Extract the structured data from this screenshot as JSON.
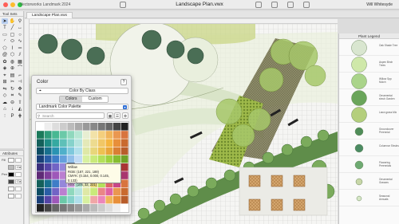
{
  "app": {
    "name": "Vectorworks Landmark 2024",
    "document_title": "Landscape Plan.vwx",
    "user": "Will Whitesyde",
    "traffic_lights": [
      "#ff5f57",
      "#febc2e",
      "#28c840"
    ]
  },
  "tabs": [
    {
      "label": "Landscape Plan.vwx"
    }
  ],
  "toolset": {
    "title": "Tool Sets",
    "tools": [
      {
        "icon": "selection-arrow-icon",
        "glyph": "➤"
      },
      {
        "icon": "pan-hand-icon",
        "glyph": "✋"
      },
      {
        "icon": "zoom-icon",
        "glyph": "⚲"
      },
      {
        "icon": "text-icon",
        "glyph": "T"
      },
      {
        "icon": "line-icon",
        "glyph": "╱"
      },
      {
        "icon": "dimension-icon",
        "glyph": "↔"
      },
      {
        "icon": "rectangle-icon",
        "glyph": "▭"
      },
      {
        "icon": "rounded-rectangle-icon",
        "glyph": "▢"
      },
      {
        "icon": "circle-icon",
        "glyph": "○"
      },
      {
        "icon": "arc-icon",
        "glyph": "◜"
      },
      {
        "icon": "oval-icon",
        "glyph": "⬭"
      },
      {
        "icon": "freehand-icon",
        "glyph": "∿"
      },
      {
        "icon": "polygon-icon",
        "glyph": "⬠"
      },
      {
        "icon": "polyline-icon",
        "glyph": "⌇"
      },
      {
        "icon": "double-line-icon",
        "glyph": "═"
      },
      {
        "icon": "spiral-icon",
        "glyph": "@"
      },
      {
        "icon": "regular-polygon-icon",
        "glyph": "⬡"
      },
      {
        "icon": "offset-icon",
        "glyph": "⫽"
      },
      {
        "icon": "plant-icon",
        "glyph": "✿"
      },
      {
        "icon": "massing-icon",
        "glyph": "◍"
      },
      {
        "icon": "hardscape-icon",
        "glyph": "▦"
      },
      {
        "icon": "site-modifier-icon",
        "glyph": "◈"
      },
      {
        "icon": "irrigation-icon",
        "glyph": "⊕"
      },
      {
        "icon": "pipe-icon",
        "glyph": "⌒"
      },
      {
        "icon": "eyedropper-icon",
        "glyph": "⌖"
      },
      {
        "icon": "attribute-mapping-icon",
        "glyph": "▤"
      },
      {
        "icon": "fillet-icon",
        "glyph": "⌐"
      },
      {
        "icon": "connect-combine-icon",
        "glyph": "⊞"
      },
      {
        "icon": "split-icon",
        "glyph": "✂"
      },
      {
        "icon": "trim-icon",
        "glyph": "⊣"
      },
      {
        "icon": "mirror-icon",
        "glyph": "⇋"
      },
      {
        "icon": "rotate-icon",
        "glyph": "↻"
      },
      {
        "icon": "move-icon",
        "glyph": "✥"
      },
      {
        "icon": "reshape-icon",
        "glyph": "◇"
      },
      {
        "icon": "label-icon",
        "glyph": "⌗"
      },
      {
        "icon": "callout-icon",
        "glyph": "✎"
      },
      {
        "icon": "revision-cloud-icon",
        "glyph": "☁"
      },
      {
        "icon": "section-marker-icon",
        "glyph": "⊖"
      },
      {
        "icon": "north-arrow-icon",
        "glyph": "⇧"
      },
      {
        "icon": "survey-input-icon",
        "glyph": "⌂"
      },
      {
        "icon": "stake-icon",
        "glyph": "↓"
      },
      {
        "icon": "grade-icon",
        "glyph": "◭"
      },
      {
        "icon": "road-icon",
        "glyph": "⫶"
      },
      {
        "icon": "parking-icon",
        "glyph": "P"
      },
      {
        "icon": "fence-icon",
        "glyph": "⋕"
      }
    ]
  },
  "attributes": {
    "title": "Attributes",
    "rows": [
      {
        "label": "Fill",
        "swatch": "#ffffff",
        "value": ""
      },
      {
        "label": "",
        "swatch": "#bbbbbb",
        "value": "Class Style"
      },
      {
        "label": "Pen",
        "swatch": "#000000",
        "value": ""
      },
      {
        "label": "",
        "swatch": "#444444",
        "value": "Class Style"
      },
      {
        "label": "",
        "swatch": "#ffffff",
        "value": ""
      },
      {
        "label": "",
        "swatch": "#ffffff",
        "value": ""
      }
    ]
  },
  "color_dialog": {
    "title": "Color",
    "help_label": "?",
    "by_class_label": "Color By Class",
    "tabs": [
      {
        "label": "Colors",
        "active": true
      },
      {
        "label": "Custom",
        "active": false
      }
    ],
    "palette_select": "Landmark Color Palette",
    "search_placeholder": "Search",
    "tooltip": {
      "name": "Willow",
      "rgb": "RGB: (187, 221, 189)",
      "cmyk": "CMYK: (0.154, 0.000, 0.145, 0.133)",
      "hsv": "HSV: (105, 32, 221)"
    }
  },
  "plant_list": {
    "title": "Plant Legend",
    "items": [
      {
        "color": "#d9e6d0",
        "label": "Oak Shade Tree"
      },
      {
        "color": "#cfe8a9",
        "label": "Aspen Birch Trees"
      },
      {
        "color": "#aad48a",
        "label": "Willow Spp Mulch"
      },
      {
        "color": "#6aa55a",
        "label": "Ornamental shrub Garden"
      },
      {
        "color": "#b4cf7c",
        "label": "Lawn grass Mix"
      },
      {
        "color": "#4f8c58",
        "label": "Groundcover Perennial"
      },
      {
        "color": "#4b8b63",
        "label": "Columnar Shrubs"
      },
      {
        "color": "#6eaa72",
        "label": "Flowering Perennials"
      },
      {
        "color": "#c8d7a8",
        "label": "Ornamental Grasses"
      },
      {
        "color": "#d6e7c6",
        "label": "Seasonal Annuals"
      }
    ]
  },
  "colors": {
    "selection": "#b9cff0",
    "accent": "#2f6fd6"
  }
}
